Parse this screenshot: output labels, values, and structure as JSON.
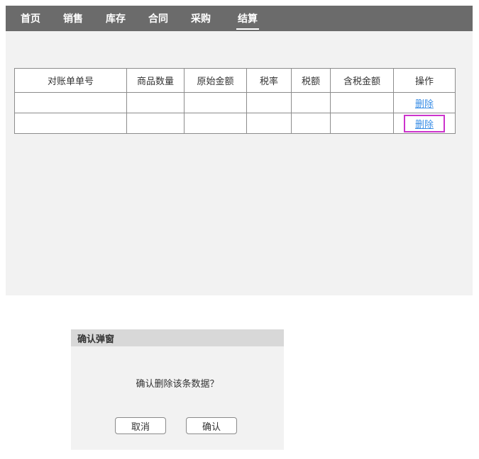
{
  "nav": {
    "items": [
      "首页",
      "销售",
      "库存",
      "合同",
      "采购",
      "结算"
    ],
    "active": "结算"
  },
  "table": {
    "headers": [
      "对账单单号",
      "商品数量",
      "原始金额",
      "税率",
      "税额",
      "含税金额",
      "操作"
    ],
    "rows": [
      {
        "cells": [
          "",
          "",
          "",
          "",
          "",
          ""
        ],
        "action": "删除"
      },
      {
        "cells": [
          "",
          "",
          "",
          "",
          "",
          ""
        ],
        "action": "删除"
      }
    ]
  },
  "dialog": {
    "title": "确认弹窗",
    "message": "确认删除该条数据？",
    "cancel_label": "取消",
    "confirm_label": "确认"
  },
  "colors": {
    "navbar": "#6b6b6b",
    "page_bg": "#f2f2f2",
    "link": "#3a8ee6",
    "highlight": "#cc33cc"
  }
}
